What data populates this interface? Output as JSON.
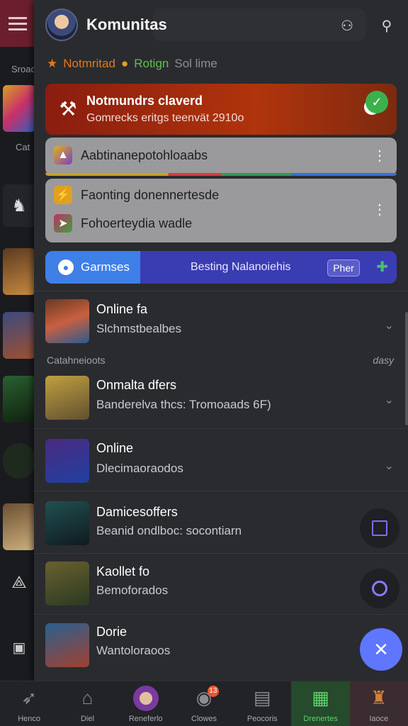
{
  "rail": {
    "label_top": "Sroac",
    "label_mid": "Cat"
  },
  "header": {
    "title": "Komunitas",
    "icons": [
      "user-icon",
      "pin-icon"
    ]
  },
  "meta": {
    "tag1": "Notmritad",
    "tag2": "Rotign",
    "tag3": "Sol lime"
  },
  "notice": {
    "title": "Notmundrs claverd",
    "subtitle": "Gomrecks eritgs teenvät 2910o"
  },
  "grey_card_1": {
    "label": "Aabtinanepotohloaabs"
  },
  "grey_card_2": {
    "row1": "Faonting donennertesde",
    "row2": "Fohoerteydia wadle"
  },
  "tabs": {
    "games": "Garmses",
    "best": "Besting Nalanoiehis",
    "plus": "Pher"
  },
  "section": {
    "left": "Catahneioots",
    "right": "dasy"
  },
  "items": [
    {
      "title": "Online fa",
      "subtitle": "Slchmstbealbes"
    },
    {
      "title": "Onmalta dfers",
      "subtitle": "Banderelva thcs: Tromoaads 6F)"
    },
    {
      "title": "Online",
      "subtitle": "Dlecimaoraodos"
    },
    {
      "title": "Damicesoffers",
      "subtitle": "Beanid ondlboc: socontiarn"
    },
    {
      "title": "Kaollet fo",
      "subtitle": "Bemoforados"
    },
    {
      "title": "Dorie",
      "subtitle": "Wantoloraoos"
    }
  ],
  "bottom_nav": [
    {
      "label": "Henco",
      "icon": "bird-icon"
    },
    {
      "label": "Diel",
      "icon": "home-icon"
    },
    {
      "label": "Reneferlo",
      "icon": "avatar-icon"
    },
    {
      "label": "Clowes",
      "icon": "chat-icon",
      "badge": "13"
    },
    {
      "label": "Peocoris",
      "icon": "shop-icon"
    },
    {
      "label": "Drenertes",
      "icon": "robot-icon"
    },
    {
      "label": "Iaoce",
      "icon": "hero-icon"
    }
  ],
  "colors": {
    "accent": "#3e7fe8",
    "active_nav": "#5fd26a",
    "alert": "#b0340c",
    "fab": "#5f76ff"
  }
}
